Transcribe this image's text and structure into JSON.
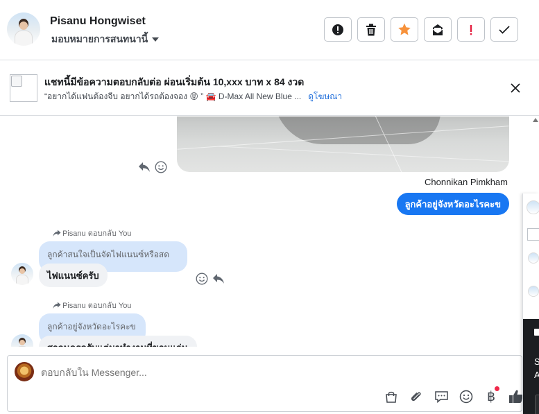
{
  "header": {
    "contact_name": "Pisanu Hongwiset",
    "assign_label": "มอบหมายการสนทนานี้",
    "actions": [
      {
        "name": "spam-report",
        "icon": "alert-circle-icon"
      },
      {
        "name": "delete",
        "icon": "trash-icon"
      },
      {
        "name": "star",
        "icon": "star-icon"
      },
      {
        "name": "mark-unread",
        "icon": "envelope-icon"
      },
      {
        "name": "follow-up",
        "icon": "exclamation-icon"
      },
      {
        "name": "done",
        "icon": "check-icon"
      }
    ]
  },
  "ad_banner": {
    "title": "แชทนี้มีข้อความตอบกลับต่อ ผ่อนเริ่มต้น 10,xxx บาท x 84 งวด",
    "subtitle": "“อยากได้แฟนต้องจีบ อยากได้รถต้องจอง 😝 ” 🚘 D-Max All New Blue ...",
    "link": "ดูโฆษณา"
  },
  "conversation": {
    "outgoing_sender": "Chonnikan Pimkham",
    "outgoing_message": "ลูกค้าอยู่จังหวัดอะไรคะข",
    "replies": [
      {
        "reply_label": "Pisanu ตอบกลับ You",
        "quoted_text": "ลูกค้าสนใจเป็นจัดไฟแนนซ์หรือสดคะ",
        "message": "ไฟแนนซ์ครับ"
      },
      {
        "reply_label": "Pisanu ตอบกลับ You",
        "quoted_text": "ลูกค้าอยู่จังหวัดอะไรคะข",
        "message": "สกลนครครับแต่มาทำงานที่ขอนแก่น"
      }
    ]
  },
  "composer": {
    "placeholder": "ตอบกลับใน Messenger...",
    "tools": [
      "shopping-bag-icon",
      "paperclip-icon",
      "speech-bubble-icon",
      "emoji-icon",
      "baht-icon",
      "thumbs-up-icon"
    ],
    "baht_symbol": "฿",
    "accent_color": "#1877f2"
  },
  "side_panel": {
    "dark_texts": [
      "S",
      "A"
    ]
  }
}
